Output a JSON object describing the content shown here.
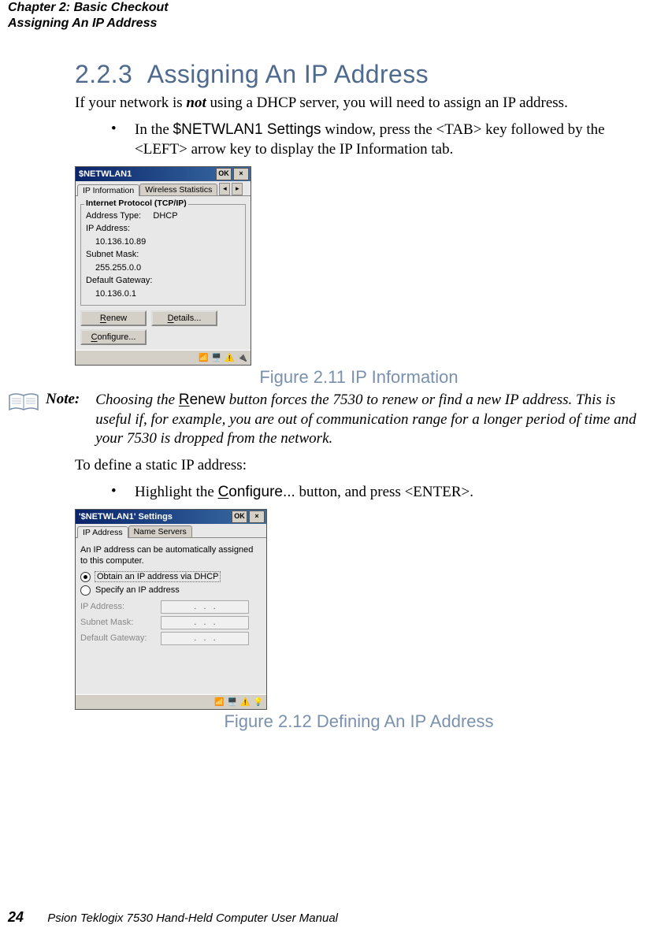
{
  "header": {
    "line1": "Chapter 2: Basic Checkout",
    "line2": "Assigning An IP Address"
  },
  "section": {
    "number": "2.2.3",
    "title": "Assigning An IP Address"
  },
  "intro": {
    "pre": "If your network is ",
    "emph": "not",
    "post": " using a DHCP server, you will need to assign an IP address."
  },
  "bullet1": {
    "pre": "In the ",
    "code": "$NETWLAN1 Settings",
    "post": " window, press the <TAB> key followed by the <LEFT> arrow key to display the IP Information tab."
  },
  "fig1": {
    "caption": "Figure 2.11 IP Information",
    "title": "$NETWLAN1",
    "tab_active": "IP Information",
    "tab_other": "Wireless Statistics",
    "group_title": "Internet Protocol (TCP/IP)",
    "rows": {
      "addr_type_label": "Address Type:",
      "addr_type_value": "DHCP",
      "ip_label": "IP Address:",
      "ip_value": "10.136.10.89",
      "mask_label": "Subnet Mask:",
      "mask_value": "255.255.0.0",
      "gw_label": "Default Gateway:",
      "gw_value": "10.136.0.1"
    },
    "btn_renew": "Renew",
    "btn_details": "Details...",
    "btn_configure": "Configure...",
    "ok": "OK",
    "close": "×"
  },
  "note": {
    "label": "Note:",
    "pre": "Choosing the ",
    "btn": "Renew",
    "post": " button forces the 7530 to renew or find a new IP address. This is useful if, for example, you are out of communication range for a longer period of time and your 7530 is dropped from the net­work."
  },
  "static_intro": "To define a static IP address:",
  "bullet2": {
    "pre": "Highlight the ",
    "code": "Configure...",
    "post": " button, and press <ENTER>."
  },
  "fig2": {
    "caption": "Figure 2.12 Defining An IP Address",
    "title": "'$NETWLAN1' Settings",
    "tab_active": "IP Address",
    "tab_other": "Name Servers",
    "desc": "An IP address can be automatically assigned to this computer.",
    "opt1": "Obtain an IP address via DHCP",
    "opt2": "Specify an IP address",
    "ip_label": "IP Address:",
    "mask_label": "Subnet Mask:",
    "gw_label": "Default Gateway:",
    "ok": "OK",
    "close": "×"
  },
  "footer": {
    "page": "24",
    "text": "Psion Teklogix 7530 Hand-Held Computer User Manual"
  }
}
